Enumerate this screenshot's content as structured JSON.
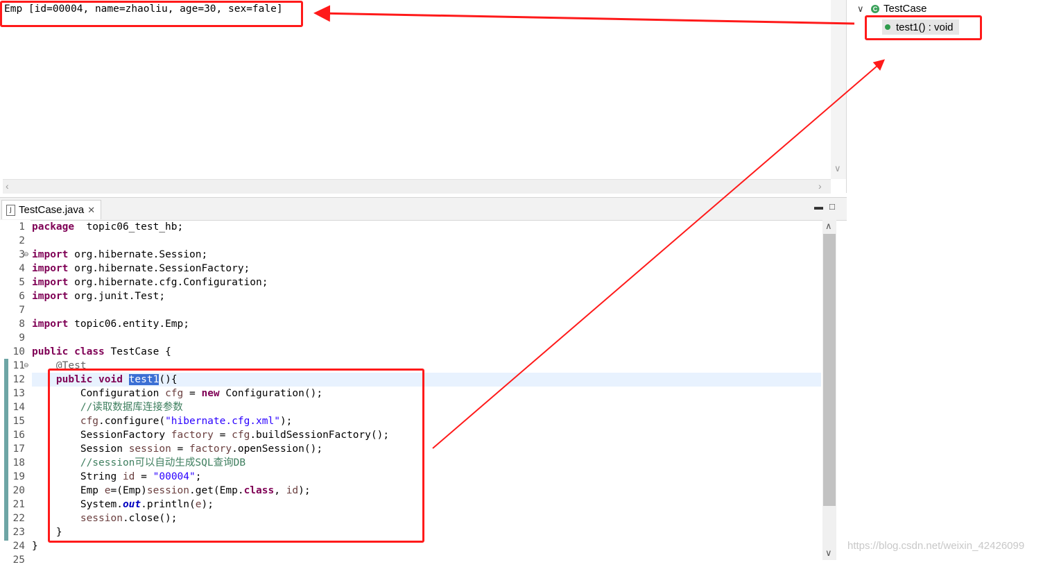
{
  "console": {
    "output": "Emp [id=00004, name=zhaoliu, age=30, sex=fale]"
  },
  "outline": {
    "class_name": "TestCase",
    "class_icon_letter": "C",
    "method": "test1() : void"
  },
  "editor": {
    "tab_title": "TestCase.java",
    "lines": [
      {
        "n": "1",
        "segs": [
          [
            "kw",
            "package"
          ],
          [
            "",
            "  topic06_test_hb;"
          ]
        ]
      },
      {
        "n": "2",
        "segs": []
      },
      {
        "n": "3",
        "segs": [
          [
            "kw",
            "import"
          ],
          [
            "",
            " org.hibernate.Session;"
          ]
        ]
      },
      {
        "n": "4",
        "segs": [
          [
            "kw",
            "import"
          ],
          [
            "",
            " org.hibernate.SessionFactory;"
          ]
        ]
      },
      {
        "n": "5",
        "segs": [
          [
            "kw",
            "import"
          ],
          [
            "",
            " org.hibernate.cfg.Configuration;"
          ]
        ]
      },
      {
        "n": "6",
        "segs": [
          [
            "kw",
            "import"
          ],
          [
            "",
            " org.junit.Test;"
          ]
        ]
      },
      {
        "n": "7",
        "segs": []
      },
      {
        "n": "8",
        "segs": [
          [
            "kw",
            "import"
          ],
          [
            "",
            " topic06.entity.Emp;"
          ]
        ]
      },
      {
        "n": "9",
        "segs": []
      },
      {
        "n": "10",
        "segs": [
          [
            "kw",
            "public"
          ],
          [
            "",
            " "
          ],
          [
            "kw",
            "class"
          ],
          [
            "",
            " TestCase {"
          ]
        ]
      },
      {
        "n": "11",
        "segs": [
          [
            "",
            "    "
          ],
          [
            "ann",
            "@Test"
          ]
        ]
      },
      {
        "n": "12",
        "segs": [
          [
            "",
            "    "
          ],
          [
            "kw",
            "public"
          ],
          [
            "",
            " "
          ],
          [
            "kw",
            "void"
          ],
          [
            "",
            " "
          ],
          [
            "sel",
            "test1"
          ],
          [
            "",
            "(){"
          ]
        ]
      },
      {
        "n": "13",
        "segs": [
          [
            "",
            "        Configuration "
          ],
          [
            "var",
            "cfg"
          ],
          [
            "",
            " = "
          ],
          [
            "kw",
            "new"
          ],
          [
            "",
            " Configuration();"
          ]
        ]
      },
      {
        "n": "14",
        "segs": [
          [
            "",
            "        "
          ],
          [
            "cm",
            "//读取数据库连接参数"
          ]
        ]
      },
      {
        "n": "15",
        "segs": [
          [
            "",
            "        "
          ],
          [
            "var",
            "cfg"
          ],
          [
            "",
            ".configure("
          ],
          [
            "str",
            "\"hibernate.cfg.xml\""
          ],
          [
            "",
            ");"
          ]
        ]
      },
      {
        "n": "16",
        "segs": [
          [
            "",
            "        SessionFactory "
          ],
          [
            "var",
            "factory"
          ],
          [
            "",
            " = "
          ],
          [
            "var",
            "cfg"
          ],
          [
            "",
            ".buildSessionFactory();"
          ]
        ]
      },
      {
        "n": "17",
        "segs": [
          [
            "",
            "        Session "
          ],
          [
            "var",
            "session"
          ],
          [
            "",
            " = "
          ],
          [
            "var",
            "factory"
          ],
          [
            "",
            ".openSession();"
          ]
        ]
      },
      {
        "n": "18",
        "segs": [
          [
            "",
            "        "
          ],
          [
            "cm",
            "//session可以自动生成SQL查询DB"
          ]
        ]
      },
      {
        "n": "19",
        "segs": [
          [
            "",
            "        String "
          ],
          [
            "var",
            "id"
          ],
          [
            "",
            " = "
          ],
          [
            "str",
            "\"00004\""
          ],
          [
            "",
            ";"
          ]
        ]
      },
      {
        "n": "20",
        "segs": [
          [
            "",
            "        Emp "
          ],
          [
            "var",
            "e"
          ],
          [
            "",
            "=(Emp)"
          ],
          [
            "var",
            "session"
          ],
          [
            "",
            ".get(Emp."
          ],
          [
            "kw",
            "class"
          ],
          [
            "",
            ", "
          ],
          [
            "var",
            "id"
          ],
          [
            "",
            ");"
          ]
        ]
      },
      {
        "n": "21",
        "segs": [
          [
            "",
            "        System."
          ],
          [
            "fld",
            "out"
          ],
          [
            "",
            ".println("
          ],
          [
            "var",
            "e"
          ],
          [
            "",
            ");"
          ]
        ]
      },
      {
        "n": "22",
        "segs": [
          [
            "",
            "        "
          ],
          [
            "var",
            "session"
          ],
          [
            "",
            ".close();"
          ]
        ]
      },
      {
        "n": "23",
        "segs": [
          [
            "",
            "    }"
          ]
        ]
      },
      {
        "n": "24",
        "segs": [
          [
            "",
            "}"
          ]
        ]
      },
      {
        "n": "25",
        "segs": []
      }
    ]
  },
  "watermark": "https://blog.csdn.net/weixin_42426099",
  "colors": {
    "annotation_red": "#ff1a1a",
    "keyword": "#7f0055",
    "string": "#2a00ff",
    "comment": "#3f7f5f",
    "local_var": "#6a3e3e",
    "selection": "#3b6fd4"
  }
}
